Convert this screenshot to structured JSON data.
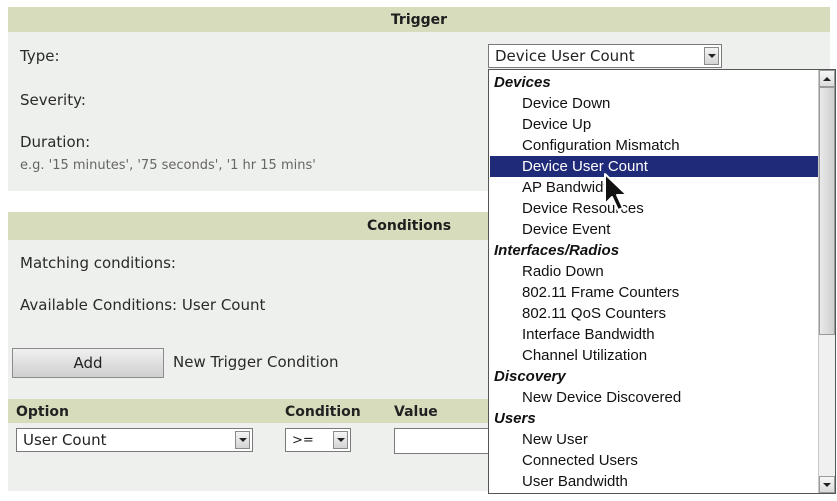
{
  "trigger": {
    "header": "Trigger",
    "type_label": "Type:",
    "severity_label": "Severity:",
    "duration_label": "Duration:",
    "duration_hint": "e.g. '15 minutes', '75 seconds', '1 hr 15 mins'",
    "type_value": "Device User Count"
  },
  "conditions": {
    "header": "Conditions",
    "matching_label": "Matching conditions:",
    "available_label": "Available Conditions: User Count",
    "add_button": "Add",
    "new_trigger_label": "New Trigger Condition",
    "columns": {
      "option": "Option",
      "condition": "Condition",
      "value": "Value"
    },
    "option_value": "User Count",
    "condition_value": ">="
  },
  "dropdown": {
    "items": [
      {
        "kind": "group",
        "label": "Devices"
      },
      {
        "kind": "item",
        "label": "Device Down"
      },
      {
        "kind": "item",
        "label": "Device Up"
      },
      {
        "kind": "item",
        "label": "Configuration Mismatch"
      },
      {
        "kind": "item",
        "label": "Device User Count",
        "selected": true
      },
      {
        "kind": "item",
        "label": "AP Bandwidth"
      },
      {
        "kind": "item",
        "label": "Device Resources"
      },
      {
        "kind": "item",
        "label": "Device Event"
      },
      {
        "kind": "group",
        "label": "Interfaces/Radios"
      },
      {
        "kind": "item",
        "label": "Radio Down"
      },
      {
        "kind": "item",
        "label": "802.11 Frame Counters"
      },
      {
        "kind": "item",
        "label": "802.11 QoS Counters"
      },
      {
        "kind": "item",
        "label": "Interface Bandwidth"
      },
      {
        "kind": "item",
        "label": "Channel Utilization"
      },
      {
        "kind": "group",
        "label": "Discovery"
      },
      {
        "kind": "item",
        "label": "New Device Discovered"
      },
      {
        "kind": "group",
        "label": "Users"
      },
      {
        "kind": "item",
        "label": "New User"
      },
      {
        "kind": "item",
        "label": "Connected Users"
      },
      {
        "kind": "item",
        "label": "User Bandwidth"
      }
    ]
  }
}
